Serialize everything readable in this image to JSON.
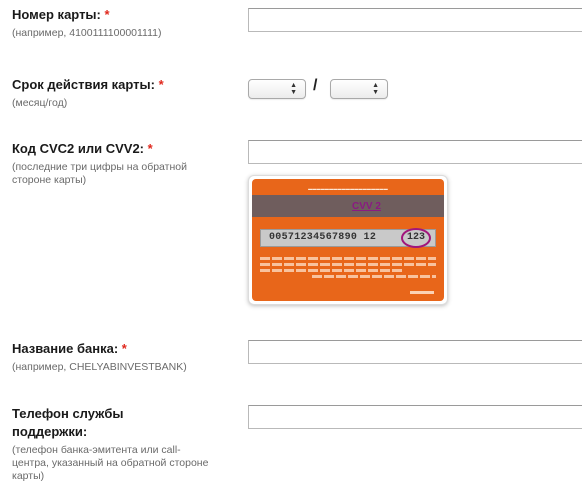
{
  "form": {
    "required_mark": "*",
    "card_number": {
      "label": "Номер карты:",
      "hint": "(например, 4100111100001111)",
      "value": ""
    },
    "expiry": {
      "label": "Срок действия карты:",
      "hint": "(месяц/год)",
      "separator": "/",
      "month_value": "",
      "year_value": ""
    },
    "cvc": {
      "label": "Код CVC2 или CVV2:",
      "hint": "(последние три цифры на обратной стороне карты)",
      "value": "",
      "card_image": {
        "cvv_caption": "CVV 2",
        "number": "00571234567890 12",
        "code": "123"
      }
    },
    "bank_name": {
      "label": "Название банка:",
      "hint": "(например, CHELYABINVESTBANK)",
      "value": ""
    },
    "support_phone": {
      "label": "Телефон службы поддержки:",
      "hint": "(телефон банка-эмитента или call-центра, указанный на обратной стороне карты)",
      "value": ""
    }
  },
  "colors": {
    "required": "#e0271c",
    "card_orange": "#e8661a",
    "cvv_highlight": "#a1167c"
  }
}
